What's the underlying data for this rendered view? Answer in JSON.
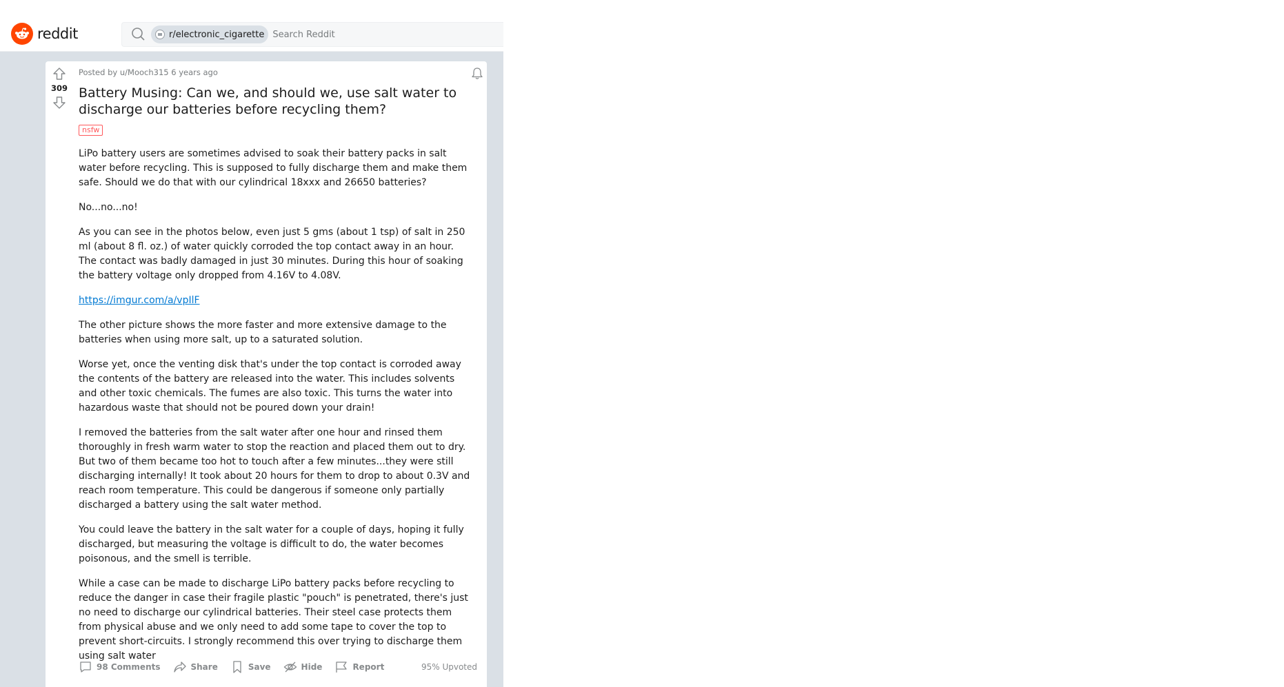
{
  "header": {
    "wordmark": "reddit",
    "search": {
      "community_chip": "r/electronic_cigarette",
      "placeholder": "Search Reddit"
    }
  },
  "post": {
    "vote_count": "309",
    "meta": "Posted by u/Mooch315 6 years ago",
    "title": "Battery Musing: Can we, and should we, use salt water to discharge our batteries before recycling them?",
    "flair": "nsfw",
    "paragraphs": [
      "LiPo battery users are sometimes advised to soak their battery packs in salt water before recycling. This is supposed to fully discharge them and make them safe. Should we do that with our cylindrical 18xxx and 26650 batteries?",
      "No...no...no!",
      "As you can see in the photos below, even just 5 gms (about 1 tsp) of salt in 250 ml (about 8 fl. oz.) of water quickly corroded the top contact away in an hour. The contact was badly damaged in just 30 minutes. During this hour of soaking the battery voltage only dropped from 4.16V to 4.08V.",
      "https://imgur.com/a/vpIlF",
      "The other picture shows the more faster and more extensive damage to the batteries when using more salt, up to a saturated solution.",
      "Worse yet, once the venting disk that's under the top contact is corroded away the contents of the battery are released into the water. This includes solvents and other toxic chemicals. The fumes are also toxic. This turns the water into hazardous waste that should not be poured down your drain!",
      "I removed the batteries from the salt water after one hour and rinsed them thoroughly in fresh warm water to stop the reaction and placed them out to dry. But two of them became too hot to touch after a few minutes...they were still discharging internally! It took about 20 hours for them to drop to about 0.3V and reach room temperature. This could be dangerous if someone only partially discharged a battery using the salt water method.",
      "You could leave the battery in the salt water for a couple of days, hoping it fully discharged, but measuring the voltage is difficult to do, the water becomes poisonous, and the smell is terrible.",
      "While a case can be made to discharge LiPo battery packs before recycling to reduce the danger in case their fragile plastic \"pouch\" is penetrated, there's just no need to discharge our cylindrical batteries. Their steel case protects them from physical abuse and we only need to add some tape to cover the top to prevent short-circuits. I strongly recommend this over trying to discharge them using salt water"
    ],
    "footer": {
      "comments": "98 Comments",
      "share": "Share",
      "save": "Save",
      "hide": "Hide",
      "report": "Report",
      "upvoted": "95% Upvoted"
    }
  },
  "colors": {
    "brand": "#ff4500",
    "link": "#0079d3",
    "nsfw": "#ff585b",
    "page_bg": "#dae0e6"
  },
  "icons": [
    "reddit-logo-icon",
    "search-icon",
    "subreddit-icon",
    "upvote-icon",
    "downvote-icon",
    "bell-icon",
    "comment-icon",
    "share-icon",
    "bookmark-icon",
    "hide-icon",
    "report-flag-icon"
  ]
}
